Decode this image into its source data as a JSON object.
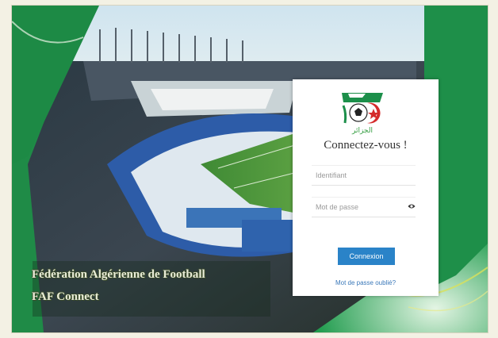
{
  "branding": {
    "title": "Fédération Algérienne de Football",
    "subtitle": "FAF Connect"
  },
  "login": {
    "heading": "Connectez-vous !",
    "logo_arabic": "الجزائر",
    "username_placeholder": "Identifiant",
    "password_placeholder": "Mot de passe",
    "submit_label": "Connexion",
    "forgot_link": "Mot de passe oublié?"
  },
  "icons": {
    "password_toggle": "eye-icon",
    "logo": "faf-logo"
  },
  "colors": {
    "brand_green": "#1c8f4a",
    "button_blue": "#2a83c8",
    "link_blue": "#3a78b9",
    "logo_red": "#d42b2b"
  }
}
